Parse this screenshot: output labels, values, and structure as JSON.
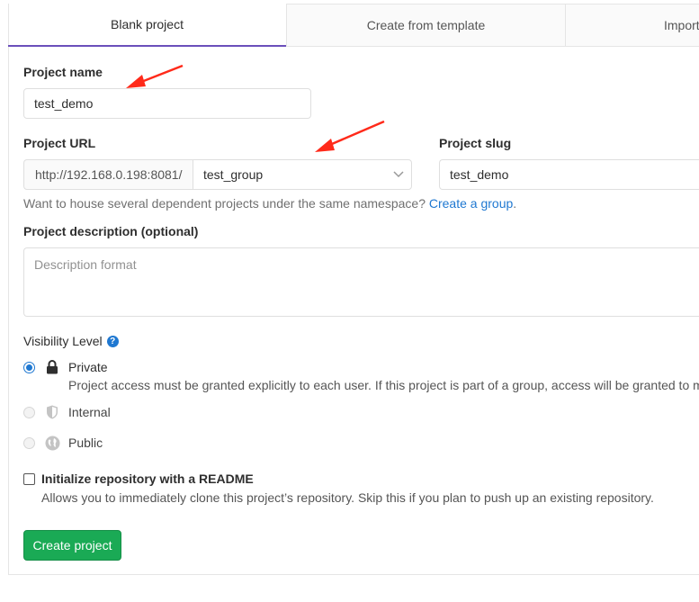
{
  "tabs": [
    {
      "label": "Blank project",
      "active": true
    },
    {
      "label": "Create from template",
      "active": false
    },
    {
      "label": "Import",
      "active": false
    }
  ],
  "form": {
    "project_name_label": "Project name",
    "project_name_value": "test_demo",
    "project_url_label": "Project URL",
    "url_prefix": "http://192.168.0.198:8081/",
    "namespace_value": "test_group",
    "project_slug_label": "Project slug",
    "project_slug_value": "test_demo",
    "namespace_help": "Want to house several dependent projects under the same namespace?",
    "namespace_help_link": "Create a group",
    "namespace_help_end": ".",
    "description_label": "Project description (optional)",
    "description_placeholder": "Description format"
  },
  "visibility": {
    "label": "Visibility Level",
    "help_icon": "question-circle-icon",
    "options": [
      {
        "label": "Private",
        "icon": "lock-icon",
        "selected": true,
        "description": "Project access must be granted explicitly to each user. If this project is part of a group, access will be granted to m"
      },
      {
        "label": "Internal",
        "icon": "shield-icon",
        "selected": false
      },
      {
        "label": "Public",
        "icon": "globe-icon",
        "selected": false
      }
    ]
  },
  "readme": {
    "label": "Initialize repository with a README",
    "description": "Allows you to immediately clone this project’s repository. Skip this if you plan to push up an existing repository.",
    "checked": false
  },
  "submit_label": "Create project",
  "colors": {
    "accent": "#6b4fbb",
    "link": "#1f78d1",
    "success": "#1aaa55",
    "annotation_arrow": "#ff2a1a"
  }
}
